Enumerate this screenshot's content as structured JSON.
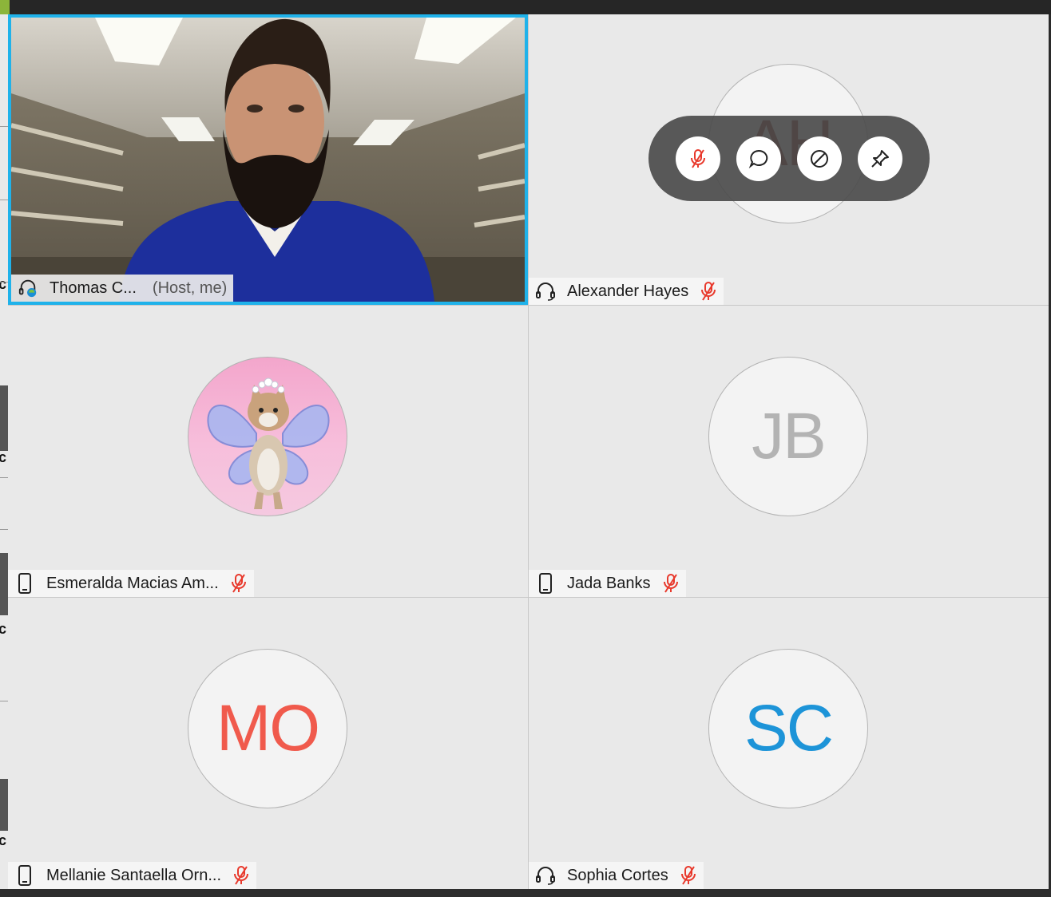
{
  "participants": [
    {
      "name": "Thomas C...",
      "role": "(Host, me)",
      "device": "headset-video-icon",
      "muted": false,
      "video": true
    },
    {
      "name": "Alexander Hayes",
      "initials": "AH",
      "device": "headset-icon",
      "muted": true
    },
    {
      "name": "Esmeralda Macias Am...",
      "device": "phone-icon",
      "muted": true,
      "avatar": "fairy-cat-photo"
    },
    {
      "name": "Jada Banks",
      "initials": "JB",
      "device": "phone-icon",
      "muted": true
    },
    {
      "name": "Mellanie Santaella Orn...",
      "initials": "MO",
      "device": "phone-icon",
      "muted": true
    },
    {
      "name": "Sophia Cortes",
      "initials": "SC",
      "device": "headset-icon",
      "muted": true
    }
  ],
  "hover_controls": [
    "mic-muted-icon",
    "chat-icon",
    "stop-video-icon",
    "pin-icon"
  ],
  "colors": {
    "active_border": "#1fb2ea",
    "muted": "#e8392c",
    "mo_initials": "#f05a4c",
    "sc_initials": "#1d94d8",
    "jb_initials": "#b3b3b3",
    "ah_initials": "#8b3a2a"
  }
}
